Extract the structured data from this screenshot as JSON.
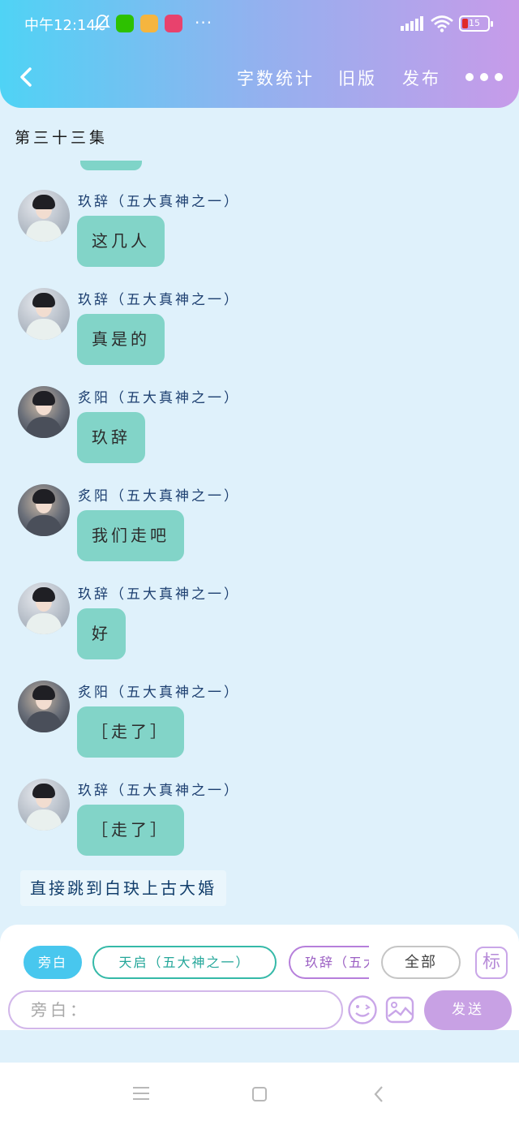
{
  "status_bar": {
    "time": "中午12:14",
    "more": "···",
    "battery": "15"
  },
  "nav": {
    "word_count": "字数统计",
    "old_version": "旧版",
    "publish": "发布"
  },
  "episode_title": "第三十三集",
  "messages": [
    {
      "name": "玖辞（五大真神之一）",
      "text": "这几人",
      "avatar": "female"
    },
    {
      "name": "玖辞（五大真神之一）",
      "text": "真是的",
      "avatar": "female"
    },
    {
      "name": "炙阳（五大真神之一）",
      "text": "玖辞",
      "avatar": "male"
    },
    {
      "name": "炙阳（五大真神之一）",
      "text": "我们走吧",
      "avatar": "male"
    },
    {
      "name": "玖辞（五大真神之一）",
      "text": "好",
      "avatar": "female"
    },
    {
      "name": "炙阳（五大真神之一）",
      "text": "［走了］",
      "avatar": "male"
    },
    {
      "name": "玖辞（五大真神之一）",
      "text": "［走了］",
      "avatar": "female"
    }
  ],
  "narration": "直接跳到白玦上古大婚",
  "panel": {
    "role_chips": {
      "narration": "旁白",
      "tianqi": "天启（五大神之一）",
      "jiuci": "玖辞（五大",
      "all": "全部"
    },
    "mark_button": "标",
    "input_placeholder": "旁白：",
    "send": "发送"
  },
  "colors": {
    "header_start": "#4fd3f5",
    "header_end": "#c79be9",
    "bubble": "#82d4c8",
    "background": "#dff1fb",
    "send": "#c8a1e4"
  }
}
